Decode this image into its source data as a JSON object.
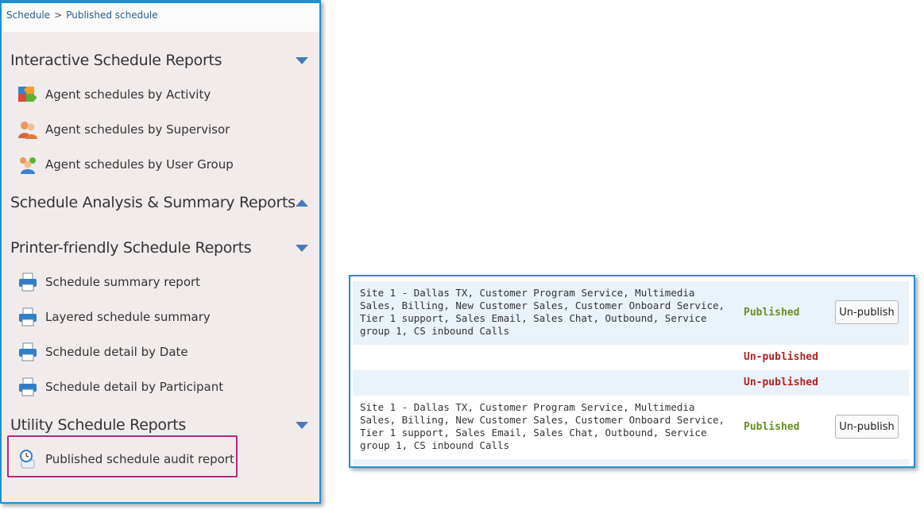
{
  "breadcrumb": {
    "root": "Schedule",
    "separator": ">",
    "current": "Published schedule"
  },
  "sections": {
    "interactive": {
      "title": "Interactive Schedule Reports",
      "items": [
        {
          "label": "Agent schedules by Activity",
          "icon": "puzzle-icon"
        },
        {
          "label": "Agent schedules by Supervisor",
          "icon": "people-icon"
        },
        {
          "label": "Agent schedules by User Group",
          "icon": "group-icon"
        }
      ]
    },
    "analysis": {
      "title": "Schedule Analysis & Summary Reports"
    },
    "printer": {
      "title": "Printer-friendly Schedule Reports",
      "items": [
        {
          "label": "Schedule summary report",
          "icon": "printer-icon"
        },
        {
          "label": "Layered schedule summary",
          "icon": "printer-icon"
        },
        {
          "label": "Schedule detail by Date",
          "icon": "printer-icon"
        },
        {
          "label": "Schedule detail by Participant",
          "icon": "printer-icon"
        }
      ]
    },
    "utility": {
      "title": "Utility Schedule Reports",
      "items": [
        {
          "label": "Published schedule audit report",
          "icon": "clock-icon"
        }
      ]
    }
  },
  "schedule_rows": [
    {
      "description": "Site 1 - Dallas TX, Customer Program Service, Multimedia Sales, Billing, New Customer Sales, Customer Onboard Service, Tier 1 support, Sales Email, Sales Chat, Outbound, Service group 1, CS inbound Calls",
      "status": "Published",
      "action": "Un-publish"
    },
    {
      "description": "",
      "status": "Un-published",
      "action": ""
    },
    {
      "description": "",
      "status": "Un-published",
      "action": ""
    },
    {
      "description": "Site 1 - Dallas TX, Customer Program Service, Multimedia Sales, Billing, New Customer Sales, Customer Onboard Service, Tier 1 support, Sales Email, Sales Chat, Outbound, Service group 1, CS inbound Calls",
      "status": "Published",
      "action": "Un-publish"
    }
  ],
  "colors": {
    "accent_border": "#1f8fcf",
    "published": "#6b8e23",
    "unpublished": "#b22222",
    "highlight": "#b02a82",
    "triangle": "#4a7ab5"
  }
}
